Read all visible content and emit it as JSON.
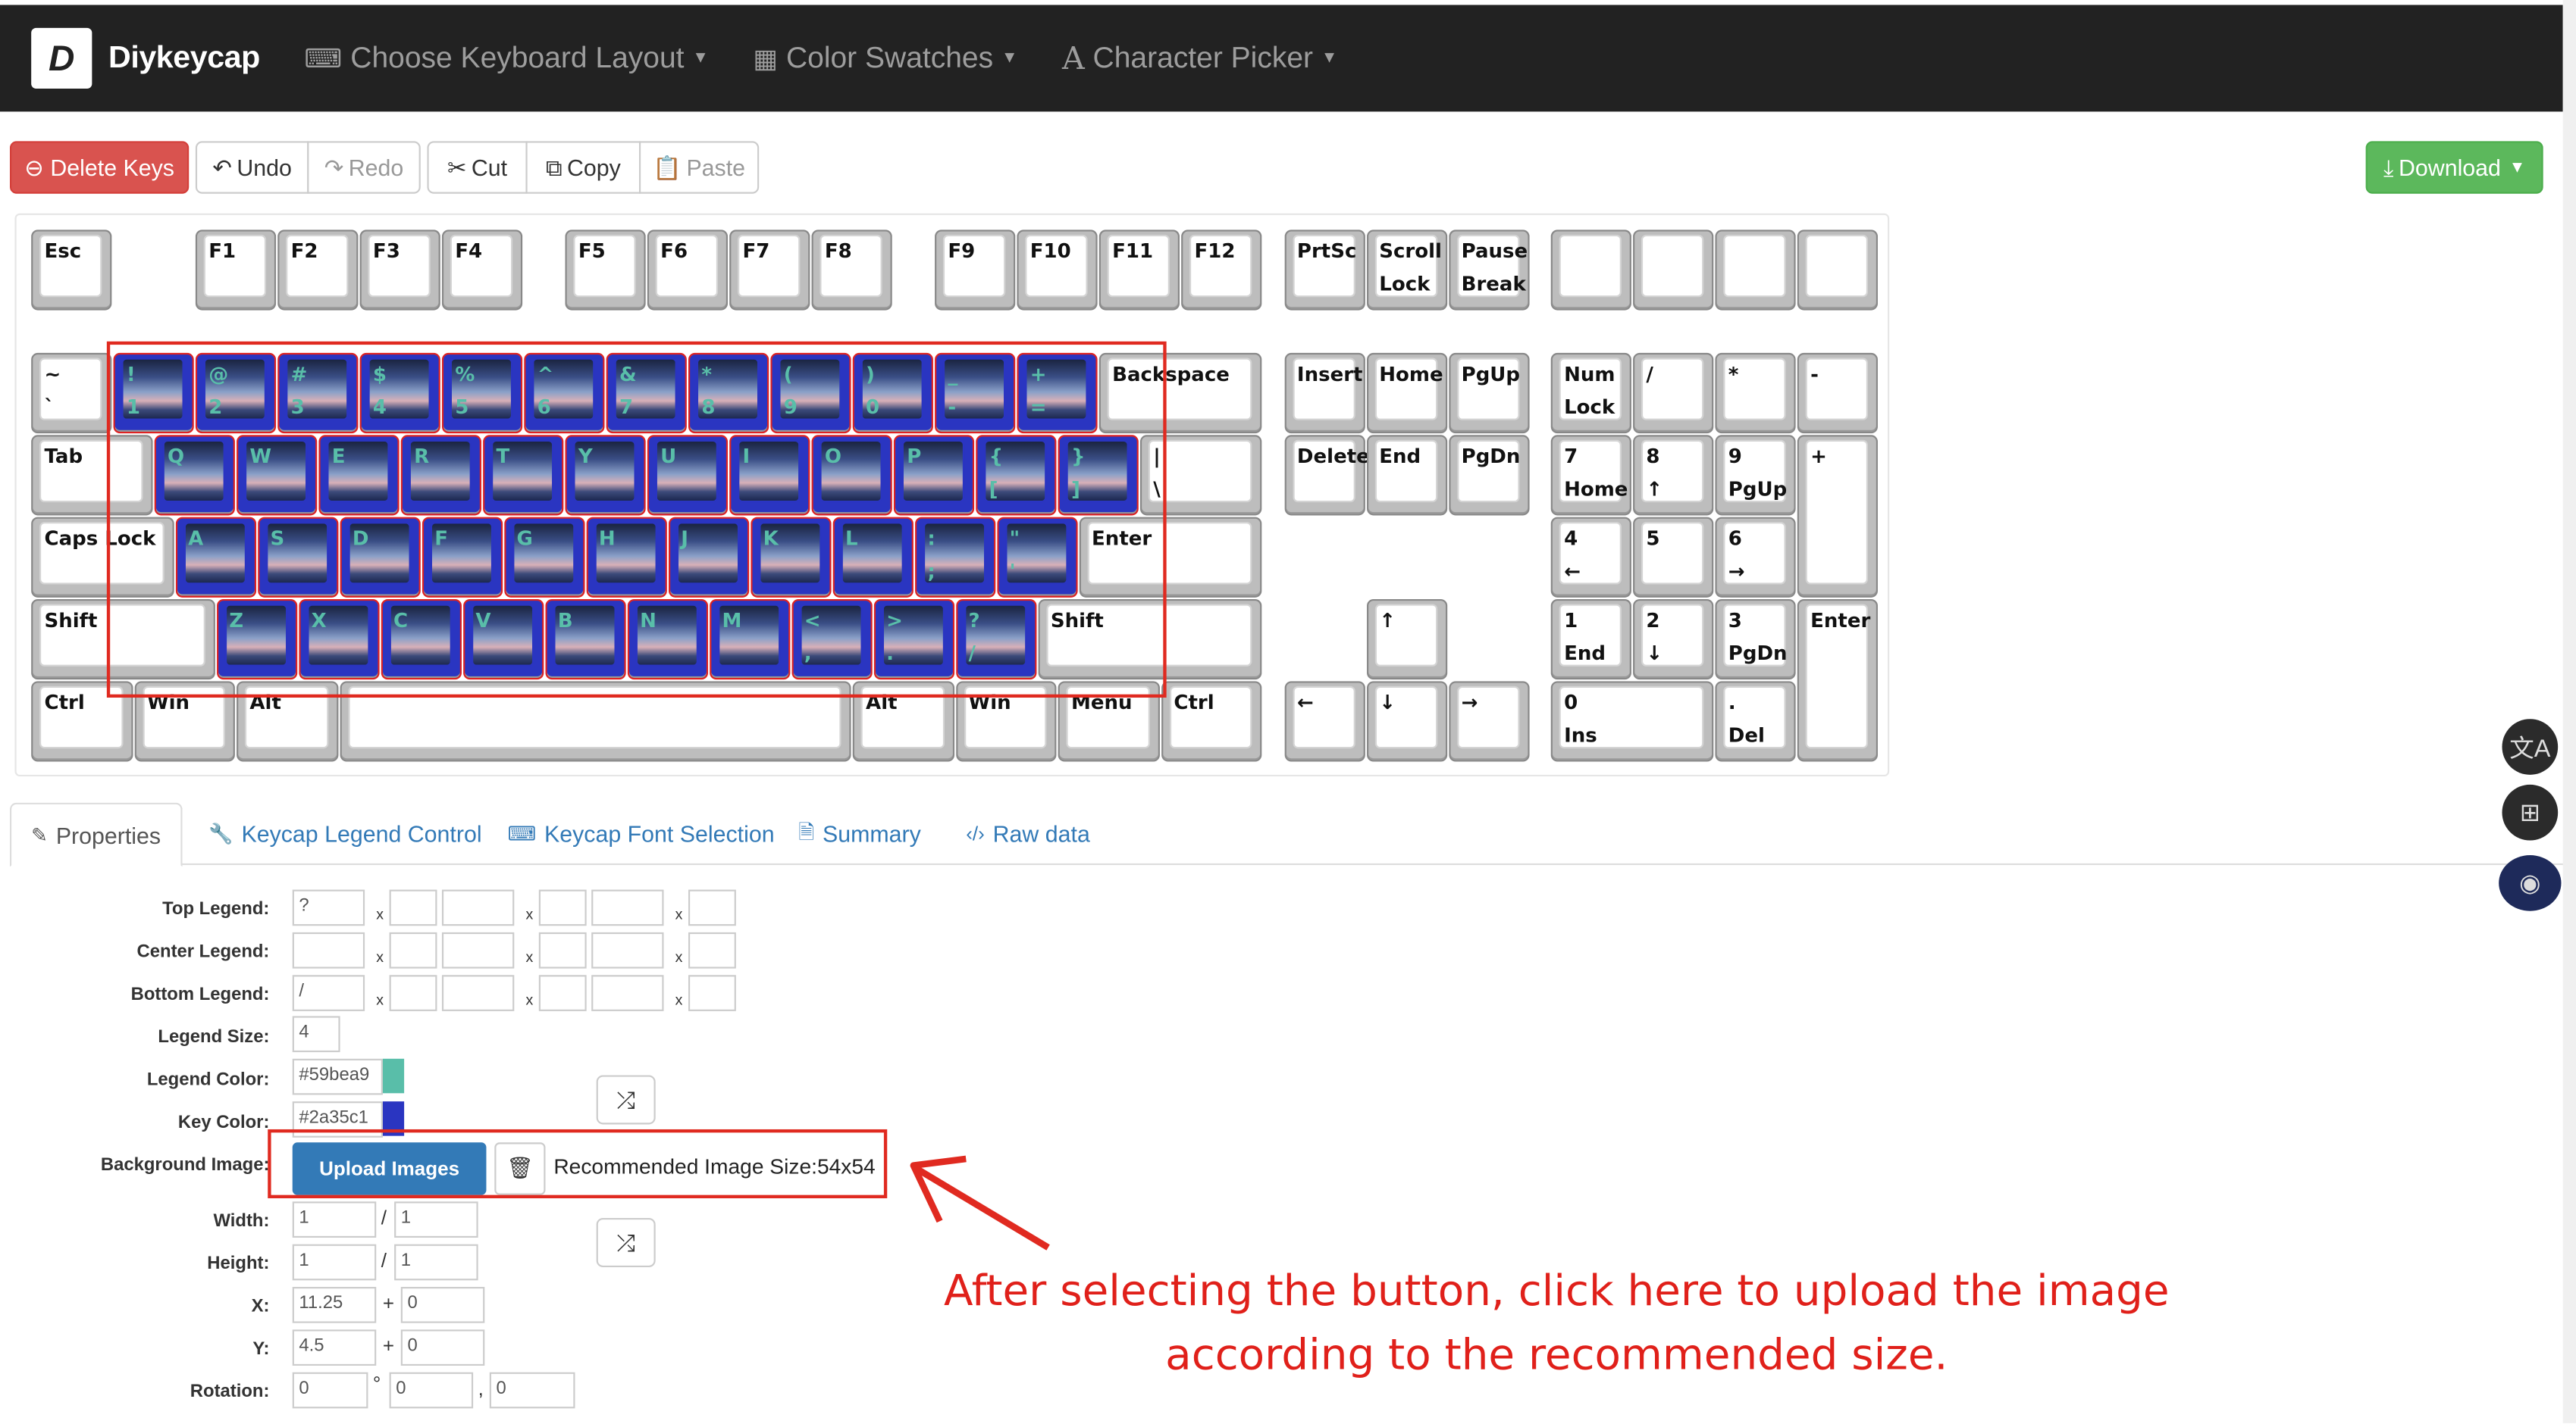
{
  "nav": {
    "brand": "Diykeycap",
    "logo": "D",
    "menus": [
      {
        "icon": "keyboard-icon",
        "glyph": "⌨",
        "label": "Choose Keyboard Layout"
      },
      {
        "icon": "grid-icon",
        "glyph": "▦",
        "label": "Color Swatches"
      },
      {
        "icon": "font-icon",
        "glyph": "A",
        "label": "Character Picker"
      }
    ]
  },
  "toolbar": {
    "delete": "Delete Keys",
    "undo": "Undo",
    "redo": "Redo",
    "cut": "Cut",
    "copy": "Copy",
    "paste": "Paste",
    "download": "Download"
  },
  "colors": {
    "legend": "#59bea9",
    "key": "#2a35c1",
    "annotation": "#e02a20"
  },
  "keys": [
    {
      "t": "Esc",
      "b": ""
    },
    {
      "t": "F1",
      "b": ""
    },
    {
      "t": "F2",
      "b": ""
    },
    {
      "t": "F3",
      "b": ""
    },
    {
      "t": "F4",
      "b": ""
    },
    {
      "t": "F5",
      "b": ""
    },
    {
      "t": "F6",
      "b": ""
    },
    {
      "t": "F7",
      "b": ""
    },
    {
      "t": "F8",
      "b": ""
    },
    {
      "t": "F9",
      "b": ""
    },
    {
      "t": "F10",
      "b": ""
    },
    {
      "t": "F11",
      "b": ""
    },
    {
      "t": "F12",
      "b": ""
    },
    {
      "t": "PrtSc",
      "b": ""
    },
    {
      "t": "Scroll",
      "b": "Lock"
    },
    {
      "t": "Pause",
      "b": "Break"
    },
    {
      "t": "",
      "b": ""
    },
    {
      "t": "",
      "b": ""
    },
    {
      "t": "",
      "b": ""
    },
    {
      "t": "",
      "b": ""
    },
    {
      "t": "~",
      "b": "`"
    },
    {
      "t": "!",
      "b": "1"
    },
    {
      "t": "@",
      "b": "2"
    },
    {
      "t": "#",
      "b": "3"
    },
    {
      "t": "$",
      "b": "4"
    },
    {
      "t": "%",
      "b": "5"
    },
    {
      "t": "^",
      "b": "6"
    },
    {
      "t": "&",
      "b": "7"
    },
    {
      "t": "*",
      "b": "8"
    },
    {
      "t": "(",
      "b": "9"
    },
    {
      "t": ")",
      "b": "0"
    },
    {
      "t": "_",
      "b": "-"
    },
    {
      "t": "+",
      "b": "="
    },
    {
      "t": "Backspace",
      "b": ""
    },
    {
      "t": "Insert",
      "b": ""
    },
    {
      "t": "Home",
      "b": ""
    },
    {
      "t": "PgUp",
      "b": ""
    },
    {
      "t": "Num",
      "b": "Lock"
    },
    {
      "t": "/",
      "b": ""
    },
    {
      "t": "*",
      "b": ""
    },
    {
      "t": "-",
      "b": ""
    },
    {
      "t": "Tab",
      "b": ""
    },
    {
      "t": "Q",
      "b": ""
    },
    {
      "t": "W",
      "b": ""
    },
    {
      "t": "E",
      "b": ""
    },
    {
      "t": "R",
      "b": ""
    },
    {
      "t": "T",
      "b": ""
    },
    {
      "t": "Y",
      "b": ""
    },
    {
      "t": "U",
      "b": ""
    },
    {
      "t": "I",
      "b": ""
    },
    {
      "t": "O",
      "b": ""
    },
    {
      "t": "P",
      "b": ""
    },
    {
      "t": "{",
      "b": "["
    },
    {
      "t": "}",
      "b": "]"
    },
    {
      "t": "|",
      "b": "\\"
    },
    {
      "t": "Delete",
      "b": ""
    },
    {
      "t": "End",
      "b": ""
    },
    {
      "t": "PgDn",
      "b": ""
    },
    {
      "t": "7",
      "b": "Home"
    },
    {
      "t": "8",
      "b": "↑"
    },
    {
      "t": "9",
      "b": "PgUp"
    },
    {
      "t": "+",
      "b": ""
    },
    {
      "t": "Caps Lock",
      "b": ""
    },
    {
      "t": "A",
      "b": ""
    },
    {
      "t": "S",
      "b": ""
    },
    {
      "t": "D",
      "b": ""
    },
    {
      "t": "F",
      "b": ""
    },
    {
      "t": "G",
      "b": ""
    },
    {
      "t": "H",
      "b": ""
    },
    {
      "t": "J",
      "b": ""
    },
    {
      "t": "K",
      "b": ""
    },
    {
      "t": "L",
      "b": ""
    },
    {
      "t": ":",
      "b": ";"
    },
    {
      "t": "\"",
      "b": "'"
    },
    {
      "t": "Enter",
      "b": ""
    },
    {
      "t": "4",
      "b": "←"
    },
    {
      "t": "5",
      "b": ""
    },
    {
      "t": "6",
      "b": "→"
    },
    {
      "t": "Shift",
      "b": ""
    },
    {
      "t": "Z",
      "b": ""
    },
    {
      "t": "X",
      "b": ""
    },
    {
      "t": "C",
      "b": ""
    },
    {
      "t": "V",
      "b": ""
    },
    {
      "t": "B",
      "b": ""
    },
    {
      "t": "N",
      "b": ""
    },
    {
      "t": "M",
      "b": ""
    },
    {
      "t": "<",
      "b": ","
    },
    {
      "t": ">",
      "b": "."
    },
    {
      "t": "?",
      "b": "/"
    },
    {
      "t": "Shift",
      "b": ""
    },
    {
      "t": "↑",
      "b": ""
    },
    {
      "t": "1",
      "b": "End"
    },
    {
      "t": "2",
      "b": "↓"
    },
    {
      "t": "3",
      "b": "PgDn"
    },
    {
      "t": "Enter",
      "b": ""
    },
    {
      "t": "Ctrl",
      "b": ""
    },
    {
      "t": "Win",
      "b": ""
    },
    {
      "t": "Alt",
      "b": ""
    },
    {
      "t": "",
      "b": ""
    },
    {
      "t": "Alt",
      "b": ""
    },
    {
      "t": "Win",
      "b": ""
    },
    {
      "t": "Menu",
      "b": ""
    },
    {
      "t": "Ctrl",
      "b": ""
    },
    {
      "t": "←",
      "b": ""
    },
    {
      "t": "↓",
      "b": ""
    },
    {
      "t": "→",
      "b": ""
    },
    {
      "t": "0",
      "b": "Ins"
    },
    {
      "t": ".",
      "b": "Del"
    }
  ],
  "tabs": [
    {
      "icon": "edit-icon",
      "glyph": "✎",
      "label": "Properties"
    },
    {
      "icon": "wrench-icon",
      "glyph": "🔧",
      "label": "Keycap Legend Control"
    },
    {
      "icon": "keyboard-icon",
      "glyph": "⌨",
      "label": "Keycap Font Selection"
    },
    {
      "icon": "file-icon",
      "glyph": "🗎",
      "label": "Summary"
    },
    {
      "icon": "code-icon",
      "glyph": "‹/›",
      "label": "Raw data"
    }
  ],
  "props": {
    "top_legend_label": "Top Legend:",
    "top_legend_value": "?",
    "center_legend_label": "Center Legend:",
    "center_legend_value": "",
    "bottom_legend_label": "Bottom Legend:",
    "bottom_legend_value": "/",
    "legend_size_label": "Legend Size:",
    "legend_size": "4",
    "legend_color_label": "Legend Color:",
    "legend_color": "#59bea9",
    "key_color_label": "Key Color:",
    "key_color": "#2a35c1",
    "bg_image_label": "Background Image:",
    "upload": "Upload Images",
    "recommended": "Recommended Image Size:54x54",
    "width_label": "Width:",
    "width": "1",
    "width2": "1",
    "height_label": "Height:",
    "height": "1",
    "height2": "1",
    "x_label": "X:",
    "x": "11.25",
    "x2": "0",
    "y_label": "Y:",
    "y": "4.5",
    "y2": "0",
    "rotation_label": "Rotation:",
    "rot1": "0",
    "rot2": "0",
    "rot3": "0",
    "x_mark": "x",
    "slash": "/",
    "plus": "+",
    "degree": "°",
    "comma": ","
  },
  "annotation": "After selecting the button, click here to upload the image according to the recommended size."
}
